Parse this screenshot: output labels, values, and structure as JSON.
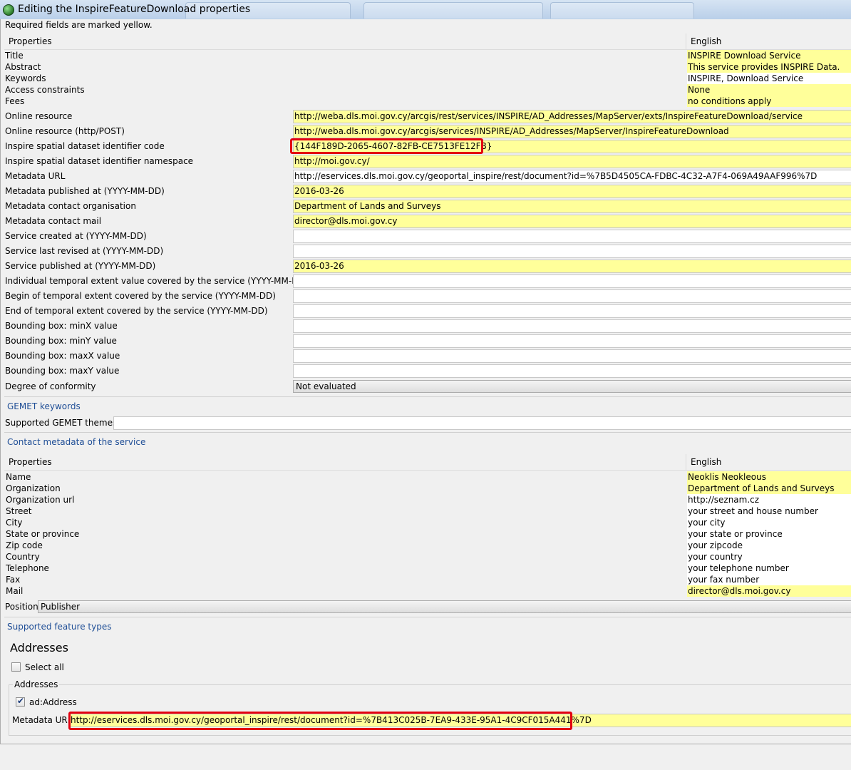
{
  "window": {
    "title": "Editing the InspireFeatureDownload properties"
  },
  "notice": "Required fields are marked yellow.",
  "service_table": {
    "headers": [
      "Properties",
      "English"
    ],
    "rows": [
      {
        "label": "Title",
        "value": "INSPIRE Download Service",
        "required": true
      },
      {
        "label": "Abstract",
        "value": "This service provides INSPIRE Data.",
        "required": true
      },
      {
        "label": "Keywords",
        "value": "INSPIRE, Download Service",
        "required": false
      },
      {
        "label": "Access constraints",
        "value": "None",
        "required": true
      },
      {
        "label": "Fees",
        "value": "no conditions apply",
        "required": true
      }
    ]
  },
  "fields": [
    {
      "label": "Online resource",
      "value": "http://weba.dls.moi.gov.cy/arcgis/rest/services/INSPIRE/AD_Addresses/MapServer/exts/InspireFeatureDownload/service",
      "required": true
    },
    {
      "label": "Online resource (http/POST)",
      "value": "http://weba.dls.moi.gov.cy/arcgis/services/INSPIRE/AD_Addresses/MapServer/InspireFeatureDownload",
      "required": true
    },
    {
      "label": "Inspire spatial dataset identifier code",
      "value": "{144F189D-2065-4607-82FB-CE7513FE12FB}",
      "required": true
    },
    {
      "label": "Inspire spatial dataset identifier namespace",
      "value": "http://moi.gov.cy/",
      "required": true
    },
    {
      "label": "Metadata URL",
      "value": "http://eservices.dls.moi.gov.cy/geoportal_inspire/rest/document?id=%7B5D4505CA-FDBC-4C32-A7F4-069A49AAF996%7D",
      "required": false
    },
    {
      "label": "Metadata published at (YYYY-MM-DD)",
      "value": "2016-03-26",
      "required": true
    },
    {
      "label": "Metadata contact organisation",
      "value": "Department of Lands and Surveys",
      "required": true
    },
    {
      "label": "Metadata contact mail",
      "value": "director@dls.moi.gov.cy",
      "required": true
    },
    {
      "label": "Service created at (YYYY-MM-DD)",
      "value": "",
      "required": false
    },
    {
      "label": "Service last revised at (YYYY-MM-DD)",
      "value": "",
      "required": false
    },
    {
      "label": "Service published at (YYYY-MM-DD)",
      "value": "2016-03-26",
      "required": true
    },
    {
      "label": "Individual temporal extent value covered by the service (YYYY-MM-DD)",
      "value": "",
      "required": false
    },
    {
      "label": "Begin of temporal extent covered by the service (YYYY-MM-DD)",
      "value": "",
      "required": false
    },
    {
      "label": "End of temporal extent covered by the service (YYYY-MM-DD)",
      "value": "",
      "required": false
    },
    {
      "label": "Bounding box: minX value",
      "value": "",
      "required": false
    },
    {
      "label": "Bounding box: minY value",
      "value": "",
      "required": false
    },
    {
      "label": "Bounding box: maxX value",
      "value": "",
      "required": false
    },
    {
      "label": "Bounding box: maxY value",
      "value": "",
      "required": false
    }
  ],
  "conformity": {
    "label": "Degree of conformity",
    "value": "Not evaluated"
  },
  "gemet": {
    "section": "GEMET keywords",
    "label": "Supported GEMET themes",
    "value": ""
  },
  "contact": {
    "section": "Contact metadata of the service",
    "headers": [
      "Properties",
      "English"
    ],
    "rows": [
      {
        "label": "Name",
        "value": "Neoklis Neokleous",
        "required": true
      },
      {
        "label": "Organization",
        "value": "Department of Lands and Surveys",
        "required": true
      },
      {
        "label": "Organization url",
        "value": "http://seznam.cz",
        "required": false
      },
      {
        "label": "Street",
        "value": "your street and house number",
        "required": false
      },
      {
        "label": "City",
        "value": "your city",
        "required": false
      },
      {
        "label": "State or province",
        "value": "your state or province",
        "required": false
      },
      {
        "label": "Zip code",
        "value": "your zipcode",
        "required": false
      },
      {
        "label": "Country",
        "value": "your country",
        "required": false
      },
      {
        "label": "Telephone",
        "value": "your telephone number",
        "required": false
      },
      {
        "label": "Fax",
        "value": "your fax number",
        "required": false
      },
      {
        "label": "Mail",
        "value": "director@dls.moi.gov.cy",
        "required": true
      }
    ],
    "position_label": "Position",
    "position_value": "Publisher"
  },
  "feature_types": {
    "section": "Supported feature types",
    "heading": "Addresses",
    "select_all_label": "Select all",
    "select_all_checked": false,
    "group_label": "Addresses",
    "item_label": "ad:Address",
    "item_checked": true,
    "metadata_label": "Metadata URL",
    "metadata_value": "http://eservices.dls.moi.gov.cy/geoportal_inspire/rest/document?id=%7B413C025B-7EA9-433E-95A1-4C9CF015A441%7D"
  },
  "colors": {
    "required": "#ffff9a",
    "highlight": "#e3000f",
    "section_text": "#1f4e96"
  }
}
